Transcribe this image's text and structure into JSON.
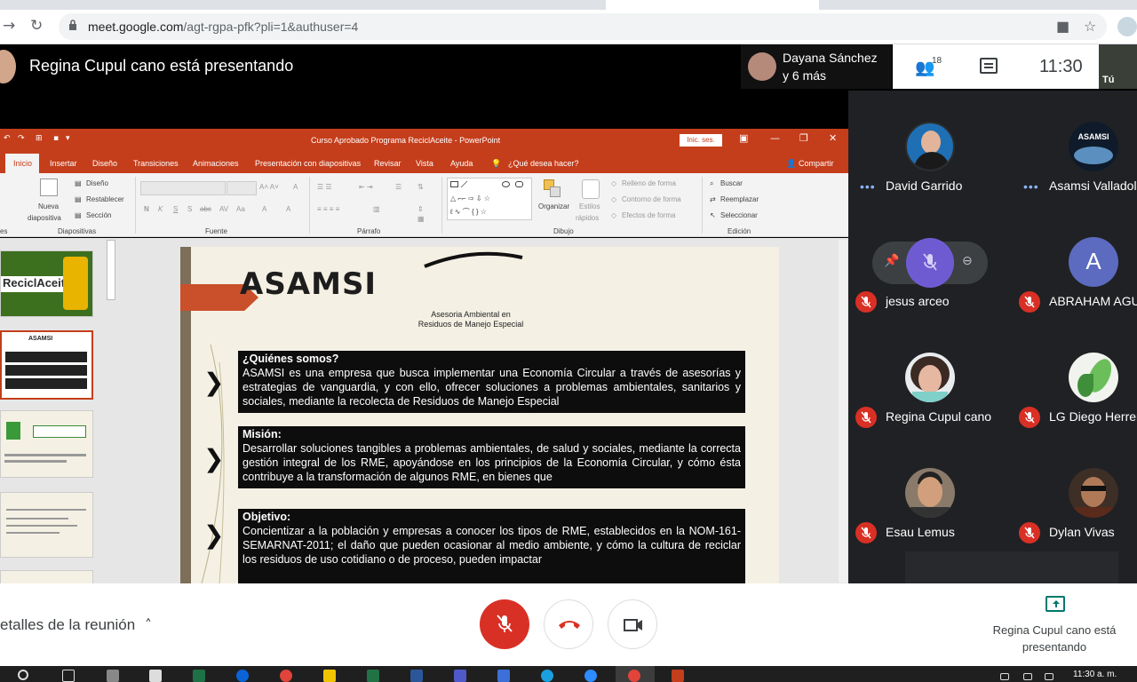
{
  "browser": {
    "url_host": "meet.google.com",
    "url_path": "/agt-rgpa-pfk?pli=1&authuser=4"
  },
  "meet": {
    "presenting_title": "Regina Cupul cano está presentando",
    "chip_name": "Dayana Sánchez",
    "chip_more": "y 6 más",
    "people_count": "18",
    "clock": "11:30",
    "self_label": "Tú"
  },
  "powerpoint": {
    "title": "Curso Aprobado Programa ReciclAceite - PowerPoint",
    "signin": "Inic. ses.",
    "tabs": [
      "Inicio",
      "Insertar",
      "Diseño",
      "Transiciones",
      "Animaciones",
      "Presentación con diapositivas",
      "Revisar",
      "Vista",
      "Ayuda"
    ],
    "tell_me": "¿Qué desea hacer?",
    "share": "Compartir",
    "ribbon": {
      "new_slide_1": "Nueva",
      "new_slide_2": "diapositiva",
      "layout": "Diseño",
      "reset": "Restablecer",
      "section": "Sección",
      "organize": "Organizar",
      "styles_1": "Estilos",
      "styles_2": "rápidos",
      "fill": "Relleno de forma",
      "outline": "Contorno de forma",
      "effects": "Efectos de forma",
      "find": "Buscar",
      "replace": "Reemplazar",
      "select": "Seleccionar",
      "group_slides": "Diapositivas",
      "group_font": "Fuente",
      "group_paragraph": "Párrafo",
      "group_drawing": "Dibujo",
      "group_editing": "Edición",
      "partial_left": "es"
    },
    "thumb1_title": "ReciclAceite",
    "slide": {
      "logo": "ASAMSI",
      "logo_sub_1": "Asesoria Ambiental en",
      "logo_sub_2": "Residuos de Manejo Especial",
      "box1_title": "¿Quiénes somos?",
      "box1_text": "ASAMSI es una empresa que busca implementar una Economía Circular a través de asesorías y estrategias de vanguardia, y con ello, ofrecer soluciones a problemas ambientales, sanitarios y sociales, mediante la recolecta de Residuos de Manejo Especial",
      "box2_title": "Misión:",
      "box2_text": "Desarrollar soluciones tangibles a problemas ambientales, de salud y sociales, mediante la correcta gestión integral de los RME, apoyándose en los principios de la Economía Circular, y cómo ésta contribuye a la transformación de algunos RME, en bienes que",
      "box3_title": "Objetivo:",
      "box3_text": "Concientizar a la población y empresas a conocer los tipos de RME, establecidos en la NOM-161-SEMARNAT-2011; el daño que pueden ocasionar al medio ambiente, y cómo la cultura de reciclar los residuos de uso cotidiano o de proceso, pueden impactar"
    }
  },
  "participants": [
    {
      "name": "David Garrido",
      "muted": false
    },
    {
      "name": "Asamsi Valladol",
      "muted": false
    },
    {
      "name": "jesus arceo",
      "muted": true
    },
    {
      "name": "ABRAHAM AGU",
      "muted": true,
      "initial": "A"
    },
    {
      "name": "Regina Cupul cano",
      "muted": true
    },
    {
      "name": "LG Diego Herrer",
      "muted": true
    },
    {
      "name": "Esau Lemus",
      "muted": true
    },
    {
      "name": "Dylan Vivas",
      "muted": true
    }
  ],
  "bottom": {
    "details": "etalles de la reunión",
    "presenting_note": "Regina Cupul cano está presentando"
  },
  "taskbar": {
    "time": "11:30 a. m."
  },
  "colors": {
    "ppt_accent": "#c43e1c",
    "end_call": "#d93025",
    "participant_bg": "#202124"
  }
}
